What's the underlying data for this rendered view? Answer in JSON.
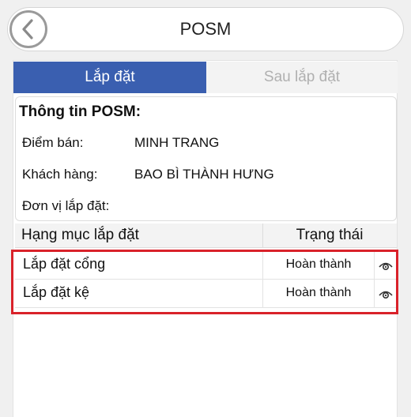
{
  "header": {
    "title": "POSM",
    "back_icon": "chevron-left-icon"
  },
  "tabs": [
    {
      "label": "Lắp đặt",
      "active": true
    },
    {
      "label": "Sau lắp đặt",
      "active": false
    }
  ],
  "info": {
    "heading": "Thông tin POSM:",
    "fields": [
      {
        "label": "Điểm bán:",
        "value": "MINH TRANG"
      },
      {
        "label": "Khách hàng:",
        "value": "BAO BÌ THÀNH HƯNG"
      },
      {
        "label": "Đơn vị lắp đặt:",
        "value": ""
      }
    ]
  },
  "table": {
    "columns": [
      "Hạng mục lắp đặt",
      "Trạng thái"
    ],
    "rows": [
      {
        "name": "Lắp đặt cổng",
        "status": "Hoàn thành",
        "action_icon": "eye-icon"
      },
      {
        "name": "Lắp đặt kệ",
        "status": "Hoàn thành",
        "action_icon": "eye-icon"
      }
    ]
  },
  "colors": {
    "tab_active": "#3a5fb0",
    "highlight_border": "#d9222a"
  }
}
